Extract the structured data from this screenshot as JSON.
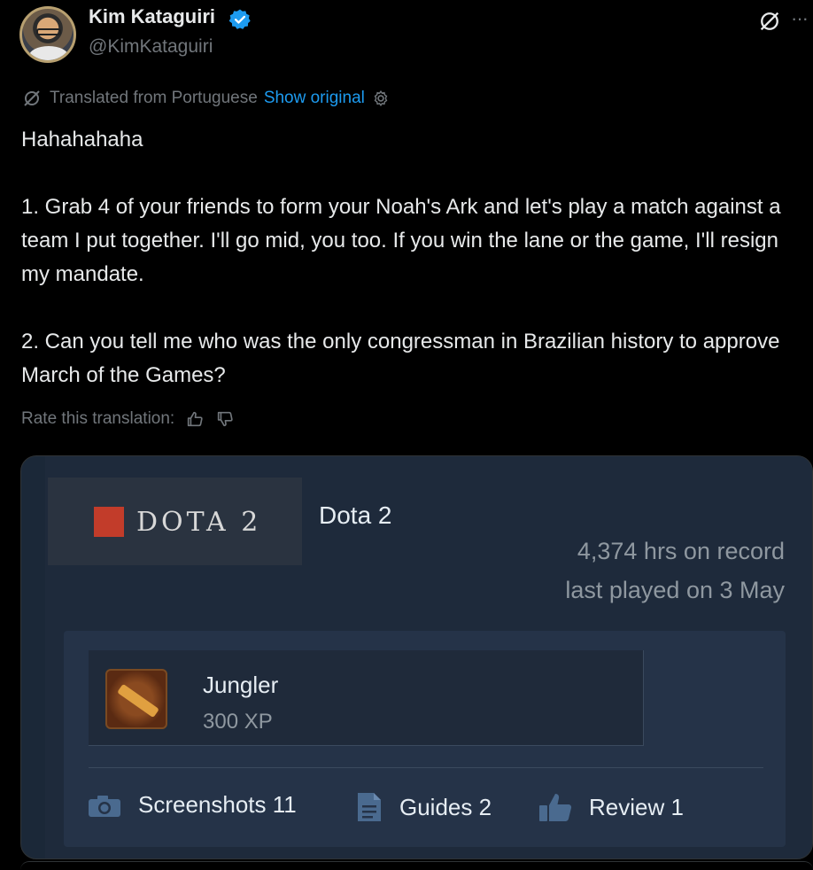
{
  "author": {
    "name": "Kim Kataguiri",
    "handle": "@KimKataguiri"
  },
  "translation": {
    "note": "Translated from Portuguese",
    "show_original": "Show original"
  },
  "tweet": {
    "line1": "Hahahahaha",
    "para1": "1. Grab 4 of your friends to form your Noah's Ark and let's play a match against a team I put together. I'll go mid, you too. If you win the lane or the game, I'll resign my mandate.",
    "para2": "2. Can you tell me who was the only congressman in Brazilian history to approve March of the Games?"
  },
  "rate": {
    "label": "Rate this translation:"
  },
  "steam_card": {
    "logo_text": "DOTA 2",
    "game_name": "Dota 2",
    "hours": "4,374 hrs on record",
    "last_played": "last played on 3 May",
    "badge": {
      "name": "Jungler",
      "xp": "300 XP"
    },
    "stats": {
      "screenshots": "Screenshots 11",
      "guides": "Guides 2",
      "review": "Review 1"
    }
  },
  "colors": {
    "accent": "#1d9bf0",
    "muted": "#71767b",
    "card_bg": "#1b2838",
    "dota_red": "#c23c2a"
  },
  "icons": [
    "verified-badge-icon",
    "grok-icon",
    "more-icon",
    "translate-icon",
    "gear-icon",
    "thumbs-up-icon",
    "thumbs-down-icon",
    "camera-icon",
    "document-icon",
    "thumbs-up-review-icon"
  ]
}
